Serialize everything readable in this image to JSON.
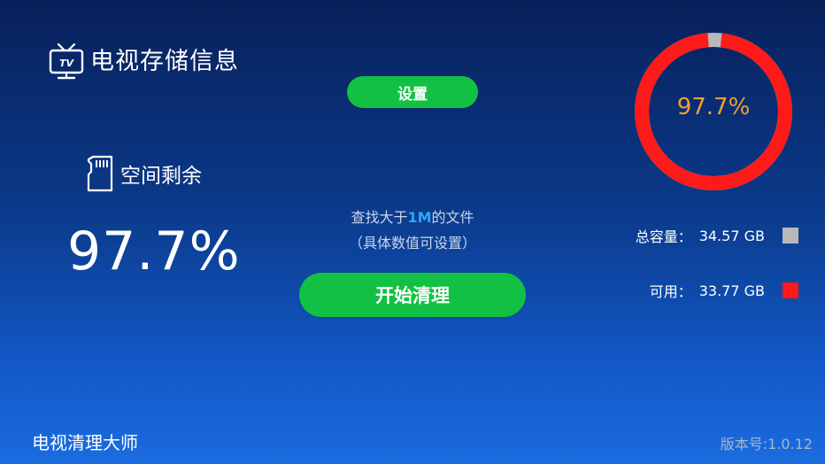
{
  "header": {
    "icon": "tv-icon",
    "title": "电视存储信息"
  },
  "left_panel": {
    "icon": "sd-card-icon",
    "space_label": "空间剩余",
    "remaining_percent_text": "97.7%"
  },
  "center": {
    "settings_label": "设置",
    "hint_prefix": "查找大于",
    "hint_highlight": "1M",
    "hint_suffix": "的文件",
    "hint_sub": "（具体数值可设置）",
    "start_label": "开始清理"
  },
  "ring": {
    "percent_text": "97.7%",
    "fraction": 0.977,
    "color_fill": "#ff1a1a",
    "color_rest": "#b8b8b8",
    "text_color": "#f0a030"
  },
  "legend": {
    "total_label": "总容量：",
    "total_value": "34.57 GB",
    "total_color": "#b8b8b8",
    "used_label": "可用：",
    "used_value": "33.77 GB",
    "used_color": "#ff1a1a"
  },
  "footer": {
    "app_name": "电视清理大师",
    "version": "版本号:1.0.12"
  },
  "colors": {
    "accent_green": "#12c144",
    "highlight_blue": "#2aa8ff"
  }
}
